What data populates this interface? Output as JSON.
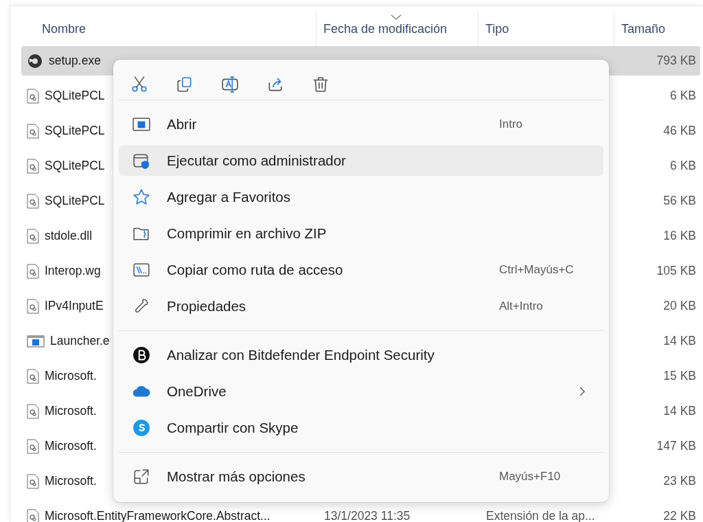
{
  "columns": [
    {
      "label": "Nombre",
      "sorted": false
    },
    {
      "label": "Fecha de modificación",
      "sorted": true
    },
    {
      "label": "Tipo",
      "sorted": false
    },
    {
      "label": "Tamaño",
      "sorted": false
    }
  ],
  "rows": [
    {
      "kind": "installer",
      "name": "setup.exe",
      "size": "793 KB",
      "selected": true
    },
    {
      "kind": "library",
      "name": "SQLitePCL",
      "size": "6 KB",
      "selected": false
    },
    {
      "kind": "library",
      "name": "SQLitePCL",
      "size": "46 KB",
      "selected": false
    },
    {
      "kind": "library",
      "name": "SQLitePCL",
      "size": "6 KB",
      "selected": false
    },
    {
      "kind": "library",
      "name": "SQLitePCL",
      "size": "56 KB",
      "selected": false
    },
    {
      "kind": "library",
      "name": "stdole.dll",
      "size": "16 KB",
      "selected": false
    },
    {
      "kind": "library",
      "name": "Interop.wg",
      "size": "105 KB",
      "selected": false
    },
    {
      "kind": "library",
      "name": "IPv4InputE",
      "size": "20 KB",
      "selected": false
    },
    {
      "kind": "application",
      "name": "Launcher.e",
      "size": "14 KB",
      "selected": false
    },
    {
      "kind": "library",
      "name": "Microsoft.",
      "size": "15 KB",
      "selected": false
    },
    {
      "kind": "library",
      "name": "Microsoft.",
      "size": "14 KB",
      "selected": false
    },
    {
      "kind": "library",
      "name": "Microsoft.",
      "size": "147 KB",
      "selected": false
    },
    {
      "kind": "library",
      "name": "Microsoft.",
      "size": "23 KB",
      "selected": false
    },
    {
      "kind": "library",
      "name": "Microsoft.EntityFrameworkCore.Abstract...",
      "date": "13/1/2023 11:35",
      "type": "Extensión de la ap...",
      "size": "22 KB",
      "selected": false
    }
  ],
  "context_menu": {
    "groups": [
      [
        {
          "label": "Abrir",
          "shortcut": "Intro",
          "submenu": false,
          "selected": false
        },
        {
          "label": "Ejecutar como administrador",
          "submenu": false,
          "selected": true
        },
        {
          "label": "Agregar a Favoritos",
          "submenu": false,
          "selected": false
        },
        {
          "label": "Comprimir en archivo ZIP",
          "submenu": false,
          "selected": false
        },
        {
          "label": "Copiar como ruta de acceso",
          "shortcut": "Ctrl+Mayús+C",
          "submenu": false,
          "selected": false
        },
        {
          "label": "Propiedades",
          "shortcut": "Alt+Intro",
          "submenu": false,
          "selected": false
        }
      ],
      [
        {
          "label": "Analizar con Bitdefender Endpoint Security",
          "submenu": false,
          "selected": false
        },
        {
          "label": "OneDrive",
          "submenu": true,
          "selected": false
        },
        {
          "label": "Compartir con Skype",
          "submenu": false,
          "selected": false
        }
      ],
      [
        {
          "label": "Mostrar más opciones",
          "shortcut": "Mayús+F10",
          "submenu": false,
          "selected": false
        }
      ]
    ]
  }
}
